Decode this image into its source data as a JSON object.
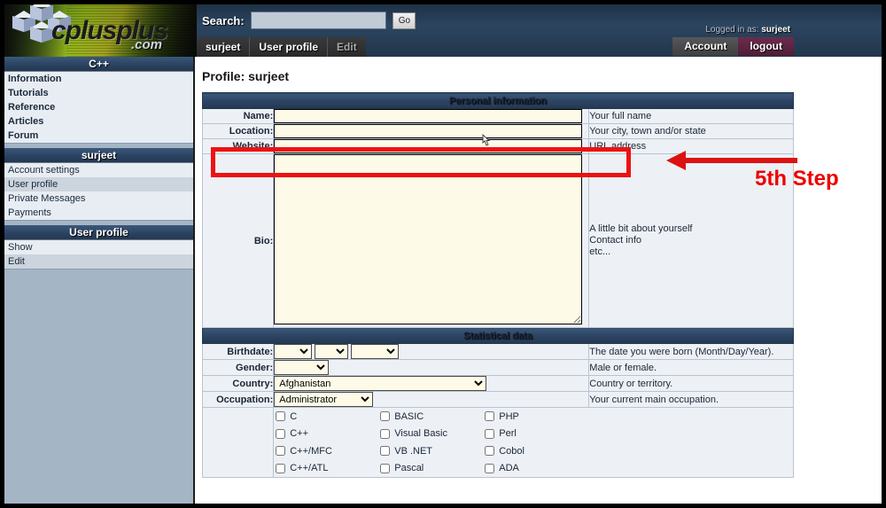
{
  "site": {
    "logo_text": "cplusplus",
    "logo_domain": ".com"
  },
  "header": {
    "search_label": "Search:",
    "search_value": "",
    "search_placeholder": "",
    "go_label": "Go",
    "logged_in_prefix": "Logged in as:",
    "logged_in_user": "surjeet",
    "account_tabs": [
      {
        "label": "Account",
        "style": "grey"
      },
      {
        "label": "logout",
        "style": "plum"
      }
    ],
    "breadcrumbs": [
      {
        "label": "surjeet",
        "current": false
      },
      {
        "label": "User profile",
        "current": false
      },
      {
        "label": "Edit",
        "current": true
      }
    ]
  },
  "sidebar": {
    "sections": [
      {
        "title": "C++",
        "items": [
          {
            "label": "Information",
            "bold": true,
            "active": false
          },
          {
            "label": "Tutorials",
            "bold": true,
            "active": false
          },
          {
            "label": "Reference",
            "bold": true,
            "active": false
          },
          {
            "label": "Articles",
            "bold": true,
            "active": false
          },
          {
            "label": "Forum",
            "bold": true,
            "active": false
          }
        ]
      },
      {
        "title": "surjeet",
        "items": [
          {
            "label": "Account settings",
            "bold": false,
            "active": false
          },
          {
            "label": "User profile",
            "bold": false,
            "active": true
          },
          {
            "label": "Private Messages",
            "bold": false,
            "active": false
          },
          {
            "label": "Payments",
            "bold": false,
            "active": false
          }
        ]
      },
      {
        "title": "User profile",
        "items": [
          {
            "label": "Show",
            "bold": false,
            "active": false
          },
          {
            "label": "Edit",
            "bold": false,
            "active": true
          }
        ]
      }
    ]
  },
  "main": {
    "page_title": "Profile: surjeet",
    "personal_section_title": "Personal information",
    "statistical_section_title": "Statistical data",
    "fields": {
      "name": {
        "label": "Name:",
        "value": "",
        "hint": "Your full name"
      },
      "location": {
        "label": "Location:",
        "value": "",
        "hint": "Your city, town and/or state"
      },
      "website": {
        "label": "Website:",
        "value": "",
        "hint": "URL address"
      },
      "bio": {
        "label": "Bio:",
        "value": "",
        "hint_line1": "A little bit about yourself",
        "hint_line2": "Contact info",
        "hint_line3": "etc..."
      },
      "birthdate": {
        "label": "Birthdate:",
        "hint": "The date you were born (Month/Day/Year).",
        "month_value": "",
        "day_value": "",
        "year_value": ""
      },
      "gender": {
        "label": "Gender:",
        "value": "",
        "hint": "Male or female."
      },
      "country": {
        "label": "Country:",
        "value": "Afghanistan",
        "hint": "Country or territory."
      },
      "occupation": {
        "label": "Occupation:",
        "value": "Administrator",
        "hint": "Your current main occupation."
      }
    },
    "languages": {
      "col1": [
        "C",
        "C++",
        "C++/MFC",
        "C++/ATL"
      ],
      "col2": [
        "BASIC",
        "Visual Basic",
        "VB .NET",
        "Pascal"
      ],
      "col3": [
        "PHP",
        "Perl",
        "Cobol",
        "ADA"
      ]
    }
  },
  "annotation": {
    "step_label": "5th Step",
    "color": "#ee0000"
  },
  "colors": {
    "header_navy": "#2c4560",
    "section_navy": "#2b4362",
    "sidebar_bg": "#a4b5c5",
    "field_cream": "#fdfbe8",
    "table_bg": "#edf1f6",
    "annotation_red": "#ee1111"
  }
}
